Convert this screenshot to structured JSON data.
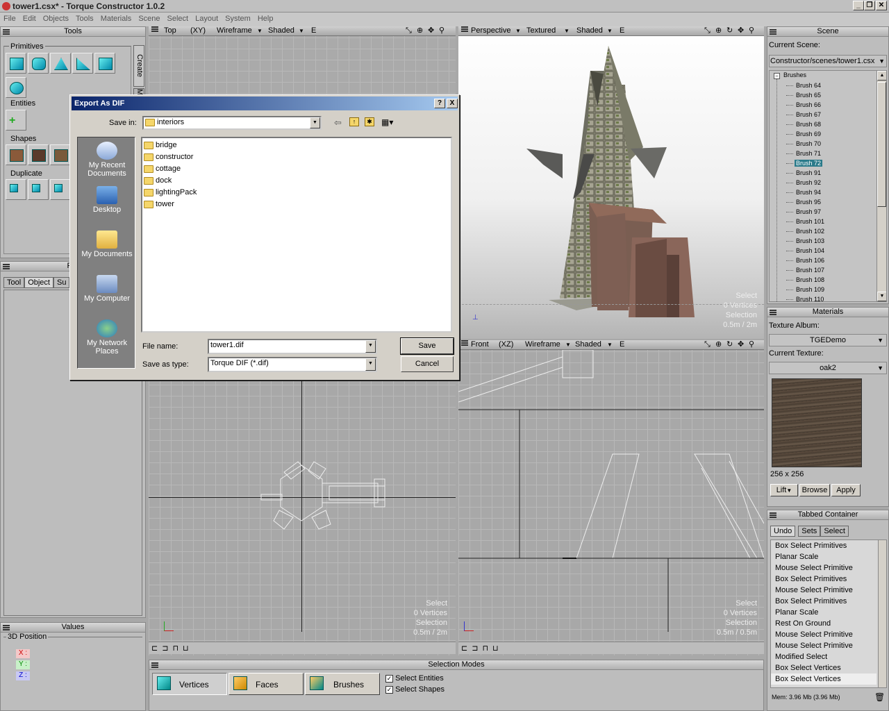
{
  "window": {
    "title": "tower1.csx* - Torque Constructor 1.0.2"
  },
  "menu": [
    "File",
    "Edit",
    "Objects",
    "Tools",
    "Materials",
    "Scene",
    "Select",
    "Layout",
    "System",
    "Help"
  ],
  "tools_panel": {
    "title": "Tools",
    "tabs": [
      "Create",
      "Modify"
    ],
    "groups": {
      "primitives": "Primitives",
      "entities": "Entities",
      "shapes": "Shapes",
      "duplicate": "Duplicate"
    }
  },
  "properties_panel": {
    "title": "Pro",
    "tabs": [
      "Tool",
      "Object",
      "Su"
    ]
  },
  "values_panel": {
    "title": "Values",
    "group": "3D Position",
    "axes": [
      "X :",
      "Y :",
      "Z :"
    ]
  },
  "viewports": {
    "top_left": {
      "view": "Top",
      "plane": "(XY)",
      "mode": "Wireframe",
      "shade": "Shaded",
      "e": "E"
    },
    "top_right": {
      "view": "Perspective",
      "mode": "Textured",
      "shade": "Shaded",
      "e": "E",
      "info": [
        "Select",
        "0 Vertices",
        "Selection",
        "0.5m / 2m"
      ]
    },
    "bottom_left": {
      "info": [
        "Select",
        "0 Vertices",
        "Selection",
        "0.5m / 2m"
      ]
    },
    "bottom_right": {
      "view": "Front",
      "plane": "(XZ)",
      "mode": "Wireframe",
      "shade": "Shaded",
      "e": "E",
      "info": [
        "Select",
        "0 Vertices",
        "Selection",
        "0.5m / 0.5m"
      ]
    }
  },
  "selection_modes": {
    "title": "Selection Modes",
    "vertices": "Vertices",
    "faces": "Faces",
    "brushes": "Brushes",
    "select_entities": "Select Entities",
    "select_shapes": "Select Shapes"
  },
  "scene_panel": {
    "title": "Scene",
    "current_label": "Current Scene:",
    "current_value": "Constructor/scenes/tower1.csx",
    "root": "Brushes",
    "items": [
      "Brush 64",
      "Brush 65",
      "Brush 66",
      "Brush 67",
      "Brush 68",
      "Brush 69",
      "Brush 70",
      "Brush 71",
      "Brush 72",
      "Brush 91",
      "Brush 92",
      "Brush 94",
      "Brush 95",
      "Brush 97",
      "Brush 101",
      "Brush 102",
      "Brush 103",
      "Brush 104",
      "Brush 106",
      "Brush 107",
      "Brush 108",
      "Brush 109",
      "Brush 110"
    ],
    "selected_index": 8
  },
  "materials_panel": {
    "title": "Materials",
    "album_label": "Texture Album:",
    "album_value": "TGEDemo",
    "texture_label": "Current Texture:",
    "texture_value": "oak2",
    "size": "256 x 256",
    "lift": "Lift",
    "browse": "Browse",
    "apply": "Apply"
  },
  "tabbed_container": {
    "title": "Tabbed Container",
    "tabs": [
      "Undo",
      "Sets",
      "Select"
    ],
    "items": [
      "Box Select Primitives",
      "Planar Scale",
      "Mouse Select Primitive",
      "Box Select Primitives",
      "Mouse Select Primitive",
      "Box Select Primitives",
      "Planar Scale",
      "Rest On Ground",
      "Mouse Select Primitive",
      "Mouse Select Primitive",
      "Modified Select",
      "Box Select Vertices",
      "Box Select Vertices"
    ],
    "mem": "Mem: 3.96 Mb (3.96 Mb)"
  },
  "dialog": {
    "title": "Export As DIF",
    "help": "?",
    "close": "X",
    "save_in_label": "Save in:",
    "save_in_value": "interiors",
    "places": [
      "My Recent Documents",
      "Desktop",
      "My Documents",
      "My Computer",
      "My Network Places"
    ],
    "folders": [
      "bridge",
      "constructor",
      "cottage",
      "dock",
      "lightingPack",
      "tower"
    ],
    "file_name_label": "File name:",
    "file_name_value": "tower1.dif",
    "type_label": "Save as type:",
    "type_value": "Torque DIF (*.dif)",
    "save": "Save",
    "cancel": "Cancel"
  },
  "colors": {
    "accent": "#0a246a",
    "selected": "#2a7a8a"
  }
}
